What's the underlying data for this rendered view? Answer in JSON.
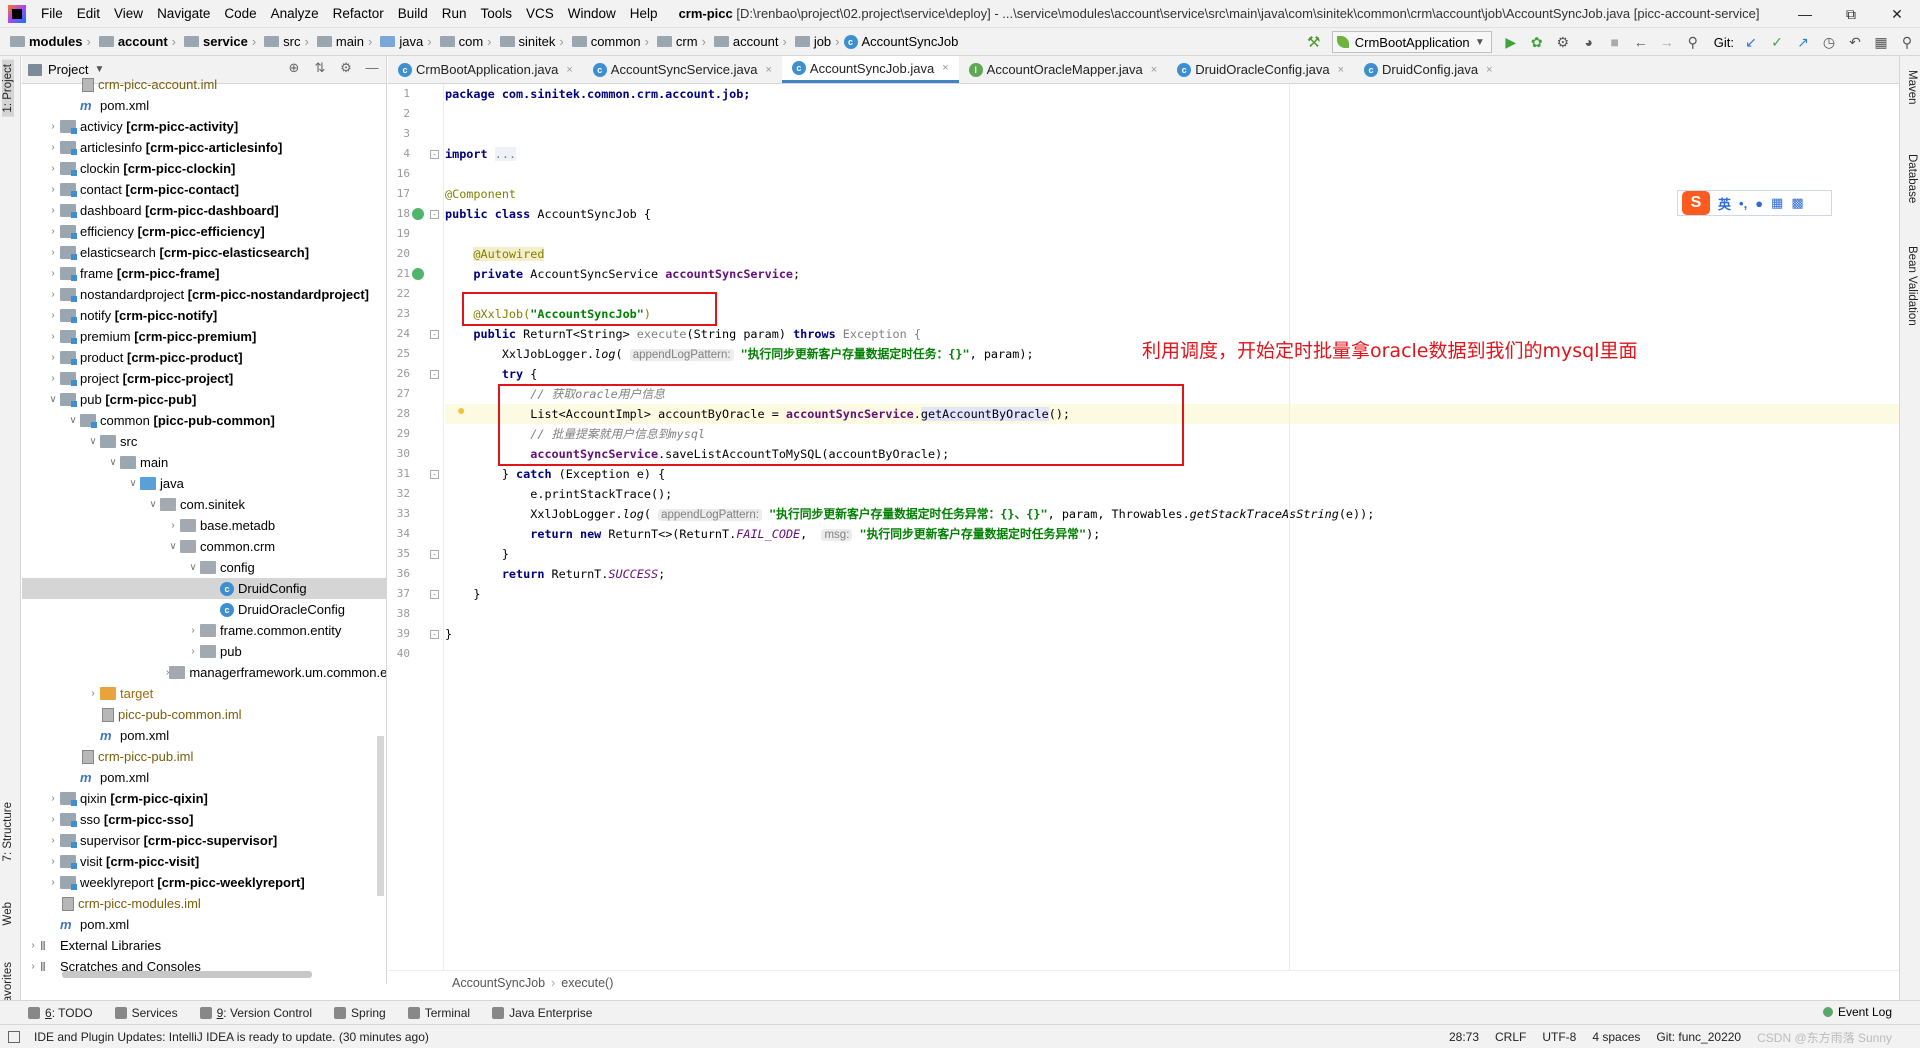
{
  "titlebar": {
    "menu": [
      "File",
      "Edit",
      "View",
      "Navigate",
      "Code",
      "Analyze",
      "Refactor",
      "Build",
      "Run",
      "Tools",
      "VCS",
      "Window",
      "Help"
    ],
    "project_name": "crm-picc",
    "path": "[D:\\renbao\\project\\02.project\\service\\deploy] - ...\\service\\modules\\account\\service\\src\\main\\java\\com\\sinitek\\common\\crm\\account\\job\\AccountSyncJob.java [picc-account-service]"
  },
  "navbar": {
    "crumbs": [
      "modules",
      "account",
      "service",
      "src",
      "main",
      "java",
      "com",
      "sinitek",
      "common",
      "crm",
      "account",
      "job",
      "AccountSyncJob"
    ],
    "run_config": "CrmBootApplication",
    "git_label": "Git:"
  },
  "left_tabs": {
    "project": "1: Project",
    "structure": "7: Structure",
    "web": "Web",
    "favorites": "2: Favorites"
  },
  "right_tabs": {
    "maven": "Maven",
    "database": "Database",
    "bean_validation": "Bean Validation"
  },
  "project_panel": {
    "title": "Project",
    "tree": [
      {
        "label": "crm-picc-account.iml",
        "icon": "iml",
        "style": "muted"
      },
      {
        "label": "pom.xml",
        "icon": "xml"
      },
      {
        "label": "activicy",
        "module": "[crm-picc-activity]",
        "icon": "module"
      },
      {
        "label": "articlesinfo",
        "module": "[crm-picc-articlesinfo]",
        "icon": "module"
      },
      {
        "label": "clockin",
        "module": "[crm-picc-clockin]",
        "icon": "module"
      },
      {
        "label": "contact",
        "module": "[crm-picc-contact]",
        "icon": "module"
      },
      {
        "label": "dashboard",
        "module": "[crm-picc-dashboard]",
        "icon": "module"
      },
      {
        "label": "efficiency",
        "module": "[crm-picc-efficiency]",
        "icon": "module"
      },
      {
        "label": "elasticsearch",
        "module": "[crm-picc-elasticsearch]",
        "icon": "module"
      },
      {
        "label": "frame",
        "module": "[crm-picc-frame]",
        "icon": "module"
      },
      {
        "label": "nostandardproject",
        "module": "[crm-picc-nostandardproject]",
        "icon": "module"
      },
      {
        "label": "notify",
        "module": "[crm-picc-notify]",
        "icon": "module"
      },
      {
        "label": "premium",
        "module": "[crm-picc-premium]",
        "icon": "module"
      },
      {
        "label": "product",
        "module": "[crm-picc-product]",
        "icon": "module"
      },
      {
        "label": "project",
        "module": "[crm-picc-project]",
        "icon": "module"
      },
      {
        "label": "pub",
        "module": "[crm-picc-pub]",
        "icon": "module"
      },
      {
        "label": "common",
        "module": "[picc-pub-common]",
        "icon": "module"
      },
      {
        "label": "src",
        "icon": "folder"
      },
      {
        "label": "main",
        "icon": "folder"
      },
      {
        "label": "java",
        "icon": "srcfolder"
      },
      {
        "label": "com.sinitek",
        "icon": "pkg"
      },
      {
        "label": "base.metadb",
        "icon": "pkg"
      },
      {
        "label": "common.crm",
        "icon": "pkg"
      },
      {
        "label": "config",
        "icon": "pkg"
      },
      {
        "label": "DruidConfig",
        "icon": "cls"
      },
      {
        "label": "DruidOracleConfig",
        "icon": "cls"
      },
      {
        "label": "frame.common.entity",
        "icon": "pkg"
      },
      {
        "label": "pub",
        "icon": "pkg"
      },
      {
        "label": "managerframework.um.common.en",
        "icon": "pkg"
      },
      {
        "label": "target",
        "icon": "orange",
        "style": "brown"
      },
      {
        "label": "picc-pub-common.iml",
        "icon": "iml",
        "style": "muted"
      },
      {
        "label": "pom.xml",
        "icon": "xml"
      },
      {
        "label": "crm-picc-pub.iml",
        "icon": "iml",
        "style": "muted"
      },
      {
        "label": "pom.xml",
        "icon": "xml"
      },
      {
        "label": "qixin",
        "module": "[crm-picc-qixin]",
        "icon": "module"
      },
      {
        "label": "sso",
        "module": "[crm-picc-sso]",
        "icon": "module"
      },
      {
        "label": "supervisor",
        "module": "[crm-picc-supervisor]",
        "icon": "module"
      },
      {
        "label": "visit",
        "module": "[crm-picc-visit]",
        "icon": "module"
      },
      {
        "label": "weeklyreport",
        "module": "[crm-picc-weeklyreport]",
        "icon": "module"
      },
      {
        "label": "crm-picc-modules.iml",
        "icon": "iml",
        "style": "muted"
      },
      {
        "label": "pom.xml",
        "icon": "xml"
      },
      {
        "label": "External Libraries",
        "icon": "lib"
      },
      {
        "label": "Scratches and Consoles",
        "icon": "lib"
      }
    ]
  },
  "editor": {
    "tabs": [
      {
        "label": "CrmBootApplication.java",
        "icon": "class"
      },
      {
        "label": "AccountSyncService.java",
        "icon": "class"
      },
      {
        "label": "AccountSyncJob.java",
        "icon": "class",
        "active": true
      },
      {
        "label": "AccountOracleMapper.java",
        "icon": "interface"
      },
      {
        "label": "DruidOracleConfig.java",
        "icon": "class"
      },
      {
        "label": "DruidConfig.java",
        "icon": "class"
      }
    ],
    "line_numbers": [
      "1",
      "2",
      "3",
      "4",
      "16",
      "17",
      "18",
      "19",
      "20",
      "21",
      "22",
      "23",
      "24",
      "25",
      "26",
      "27",
      "28",
      "29",
      "30",
      "31",
      "32",
      "33",
      "34",
      "35",
      "36",
      "37",
      "38",
      "39",
      "40"
    ],
    "code": {
      "package": "package com.sinitek.common.crm.account.job;",
      "import_kw": "import",
      "import_dots": "...",
      "component": "@Component",
      "class_decl_kw": "public class",
      "class_decl_rest": " AccountSyncJob {",
      "autowired": "@Autowired",
      "field_kw": "private",
      "field_type": " AccountSyncService ",
      "field_name": "accountSyncService",
      "field_end": ";",
      "xxljob_ann": "@XxlJob(",
      "xxljob_str": "\"AccountSyncJob\"",
      "xxljob_end": ")",
      "method_kw": "public",
      "method_ret": " ReturnT<String> ",
      "method_name": "execute",
      "method_params": "(String param) ",
      "throws_kw": "throws",
      "throws_type": " Exception {",
      "log1_pre": "XxlJobLogger.",
      "log_fn": "log",
      "log_paren": "( ",
      "hint_pattern": "appendLogPattern:",
      "log1_str": "\"执行同步更新客户存量数据定时任务：{}\"",
      "log1_end": ", param);",
      "try_kw": "try",
      "brace_open": " {",
      "comment1": "// 获取oracle用户信息",
      "list_decl": "List<AccountImpl> accountByOracle = ",
      "service_field": "accountSyncService",
      "dot": ".",
      "get_call": "getAccountByOracle",
      "get_end": "();",
      "comment2": "// 批量提案就用户信息到mysql",
      "save_call": ".saveListAccountToMySQL(accountByOracle);",
      "catch_pre": "} ",
      "catch_kw": "catch",
      "catch_rest": " (Exception e) {",
      "print_trace": "e.printStackTrace();",
      "log2_str": "\"执行同步更新客户存量数据定时任务异常：{}、{}\"",
      "log2_mid": ", param, Throwables.",
      "stack_fn": "getStackTraceAsString",
      "log2_end": "(e));",
      "return_kw": "return",
      "new_kw": "new",
      "return_fail_pre": " ReturnT<>(ReturnT.",
      "fail_code": "FAIL_CODE",
      "comma": ",  ",
      "hint_msg": "msg:",
      "fail_msg": "\"执行同步更新客户存量数据定时任务异常\"",
      "fail_end": ");",
      "close_brace": "}",
      "return_succ_pre": " ReturnT.",
      "success": "SUCCESS",
      "semicolon": ";"
    },
    "annotation_note": "利用调度，开始定时批量拿oracle数据到我们的mysql里面",
    "breadcrumb": [
      "AccountSyncJob",
      "execute()"
    ]
  },
  "ime": {
    "logo": "S",
    "lang": "英",
    "punct": "•,"
  },
  "tool_windows": [
    {
      "key": "6",
      "label": ": TODO"
    },
    {
      "key": "",
      "label": "Services"
    },
    {
      "key": "9",
      "label": ": Version Control"
    },
    {
      "key": "",
      "label": "Spring"
    },
    {
      "key": "",
      "label": "Terminal"
    },
    {
      "key": "",
      "label": "Java Enterprise"
    }
  ],
  "event_log": "Event Log",
  "status": {
    "message": "IDE and Plugin Updates: IntelliJ IDEA is ready to update. (30 minutes ago)",
    "position": "28:73",
    "line_sep": "CRLF",
    "encoding": "UTF-8",
    "indent": "4 spaces",
    "git_branch": "Git: func_20220",
    "watermark": "CSDN @东方雨落 Sunny"
  }
}
